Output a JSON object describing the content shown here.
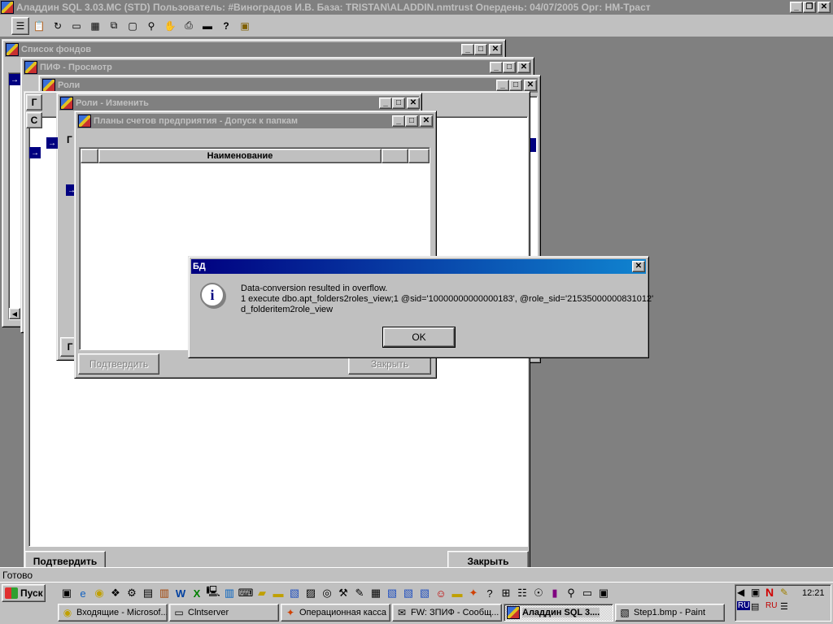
{
  "app": {
    "title": "Аладдин SQL 3.03.MC (STD)  Пользователь: #Виноградов И.В. База: TRISTAN\\ALADDIN.nmtrust Опердень: 04/07/2005 Орг: НМ-Траст",
    "status": "Готово"
  },
  "toolbar": {
    "icons": [
      "list-icon",
      "clipboard-icon",
      "refresh-icon",
      "window-icon",
      "tile-icon",
      "cascade-icon",
      "minimize-all-icon",
      "binoculars-icon",
      "stop-icon",
      "print-icon",
      "folder-icon",
      "help-icon",
      "exit-icon"
    ]
  },
  "windows": {
    "funds": {
      "title": "Список фондов"
    },
    "pif": {
      "title": "ПИФ - Просмотр"
    },
    "roles": {
      "title": "Роли"
    },
    "roles_edit": {
      "title": "Роли - Изменить"
    },
    "plans": {
      "title": "Планы счетов предприятия - Допуск к папкам",
      "column": "Наименование",
      "confirm": "Подтвердить",
      "close": "Закрыть"
    },
    "back": {
      "confirm": "Подтвердить",
      "close": "Закрыть"
    },
    "partial": {
      "tab1": "Г",
      "tab2": "С",
      "tab3": "Г",
      "tab4": "Г"
    }
  },
  "dialog": {
    "title": "БД",
    "line1": "Data-conversion resulted in overflow.",
    "line2": "1 execute dbo.apt_folders2roles_view;1 @sid='10000000000000183', @role_sid='21535000000831012'",
    "line3": "d_folderitem2role_view",
    "ok": "OK"
  },
  "taskbar": {
    "start": "Пуск",
    "clock": "12:21",
    "lang": "RU",
    "lang2": "RU",
    "tasks": [
      {
        "label": "Входящие - Microsof...",
        "icon": "outlook-icon"
      },
      {
        "label": "Clntserver",
        "icon": "app-icon"
      },
      {
        "label": "Операционная касса",
        "icon": "fox-icon"
      },
      {
        "label": "FW: ЗПИФ - Сообщ...",
        "icon": "mail-icon"
      },
      {
        "label": "Аладдин SQL 3....",
        "icon": "aladdin-icon"
      },
      {
        "label": "Step1.bmp - Paint",
        "icon": "paint-icon"
      }
    ]
  }
}
